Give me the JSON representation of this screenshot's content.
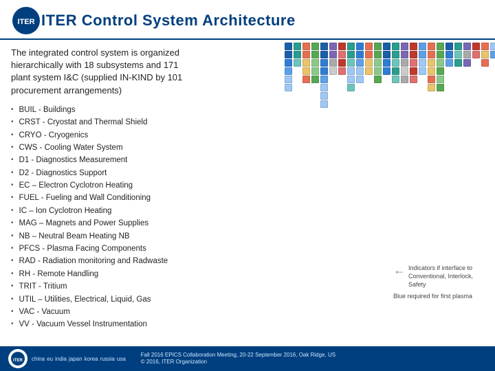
{
  "header": {
    "title": "ITER Control System Architecture"
  },
  "intro": {
    "line1": "The integrated control system is organized",
    "line2": "hierarchically  with 18 subsystems and 171",
    "line3": "plant system I&C (supplied IN-KIND by 101",
    "line4": "procurement arrangements)"
  },
  "subsystems": [
    "BUIL - Buildings",
    "CRST - Cryostat and Thermal Shield",
    "CRYO - Cryogenics",
    "CWS - Cooling Water System",
    "D1 - Diagnostics Measurement",
    "D2 - Diagnostics Support",
    "EC – Electron Cyclotron Heating",
    "FUEL - Fueling and Wall Conditioning",
    "IC – Ion Cyclotron Heating",
    "MAG – Magnets and Power Supplies",
    "NB – Neutral Beam Heating NB",
    "PFCS - Plasma Facing Components",
    "RAD - Radiation monitoring and Radwaste",
    "RH - Remote Handling",
    "TRIT - Tritium",
    "UTIL – Utilities, Electrical, Liquid, Gas",
    "VAC - Vacuum",
    "VV - Vacuum Vessel  Instrumentation"
  ],
  "annotations": [
    {
      "text": "Indicators if interface to Conventional, Interlock, Safety"
    },
    {
      "text": "Blue required for first plasma"
    }
  ],
  "footer": {
    "conference": "Fall 2016 EPICS Collaboration Meeting, 20-22 September 2016, Oak Ridge, US",
    "copyright": "© 2016, ITER Organization",
    "flags": [
      "china",
      "eu",
      "india",
      "japan",
      "korea",
      "russia",
      "usa"
    ]
  }
}
